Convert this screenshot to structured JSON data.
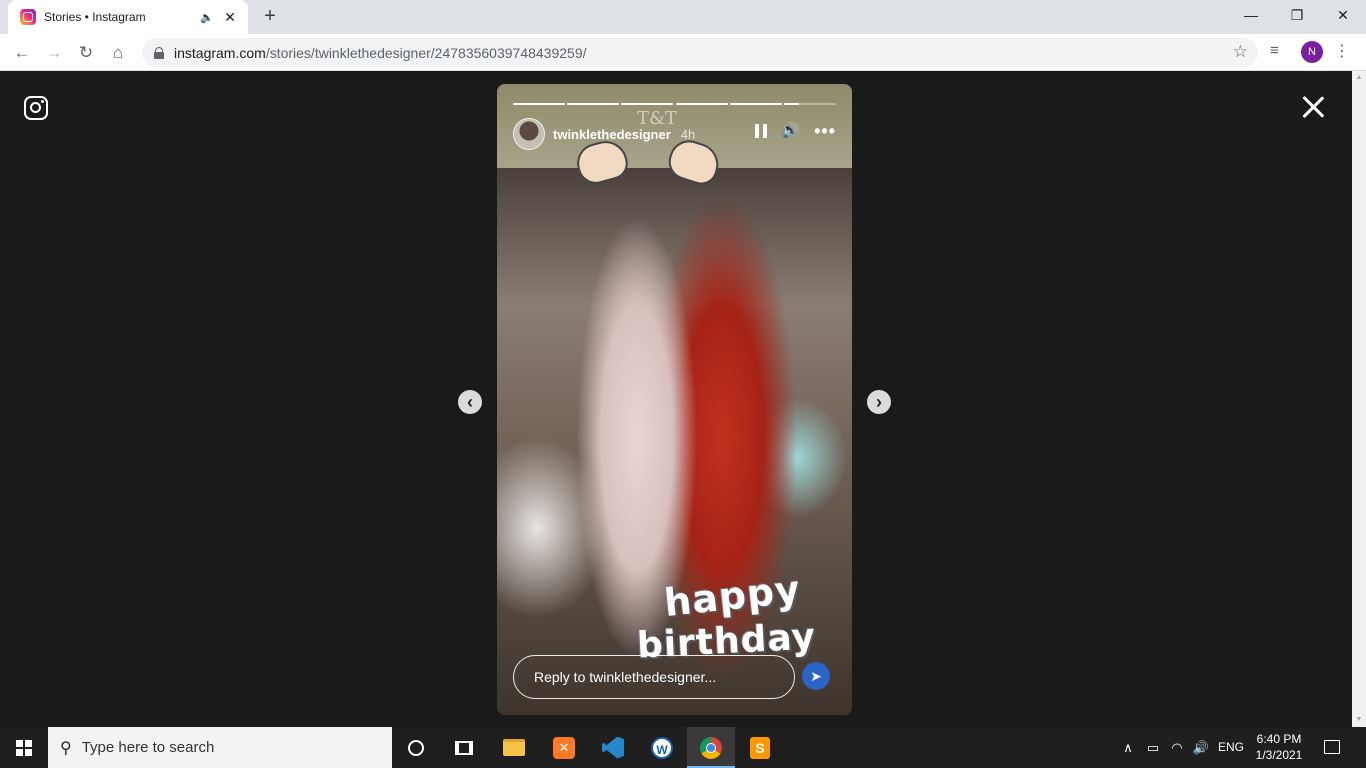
{
  "browser": {
    "tab_title": "Stories • Instagram",
    "tab_audio_icon": "speaker-icon",
    "url_host": "instagram.com",
    "url_path": "/stories/twinklethedesigner/2478356039748439259/",
    "profile_initial": "N"
  },
  "story": {
    "username": "twinklethedesigner",
    "time_ago": "4h",
    "sticker_text": "T&T",
    "text_line1": "happy",
    "text_line2": "birthday",
    "reply_placeholder": "Reply to twinklethedesigner...",
    "segment_count": 6,
    "active_segment": 6,
    "active_segment_progress": 0.3
  },
  "taskbar": {
    "search_placeholder": "Type here to search",
    "apps": [
      "cortana",
      "task-view",
      "file-explorer",
      "xampp",
      "vscode",
      "w-app",
      "chrome",
      "sublime-text"
    ],
    "language": "ENG",
    "time": "6:40 PM",
    "date": "1/3/2021"
  },
  "colors": {
    "page_bg": "#1a1a1a",
    "avatar_bg": "#7b1fa2",
    "send_bg": "#2a64c5"
  }
}
